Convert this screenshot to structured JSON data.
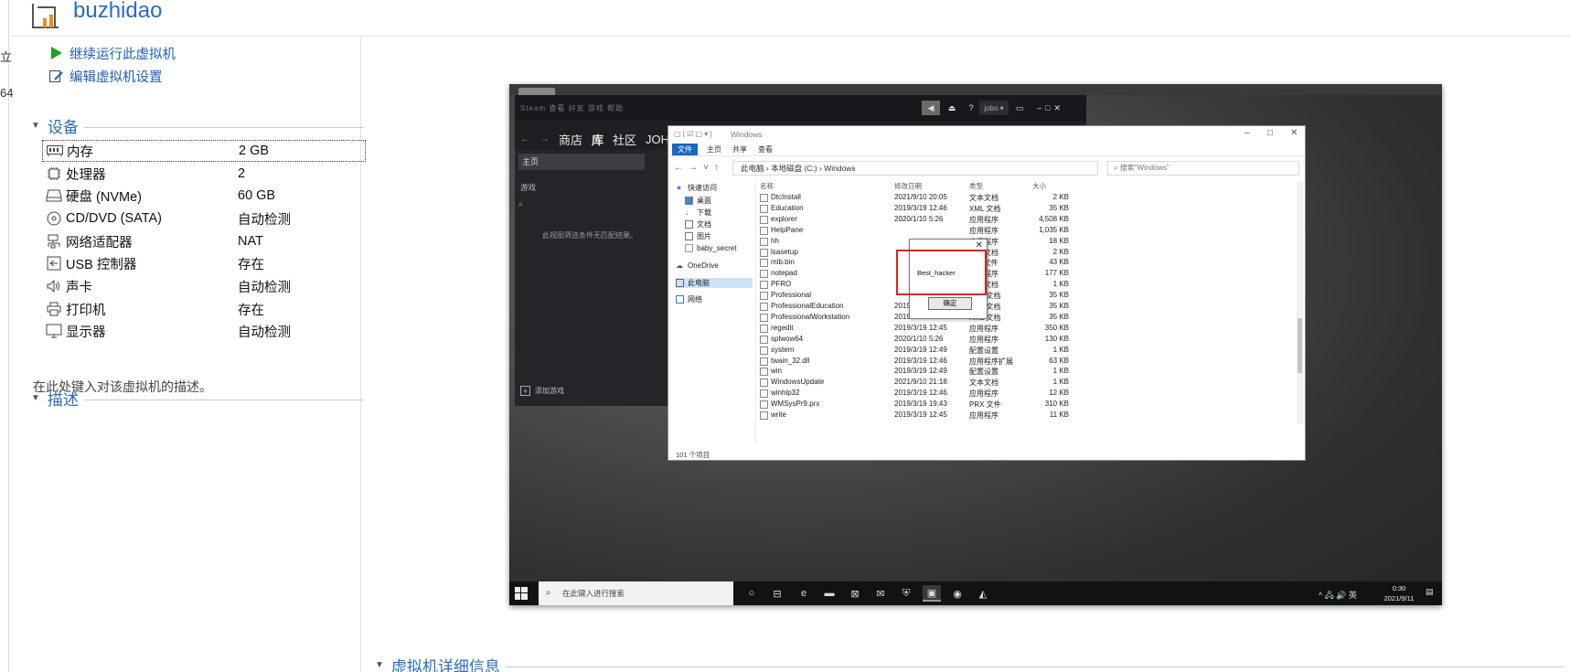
{
  "sliver": {
    "char1": "立",
    "char2": "64"
  },
  "vm": {
    "name": "buzhidao"
  },
  "actions": {
    "run": "继续运行此虚拟机",
    "edit": "编辑虚拟机设置"
  },
  "devices_section": {
    "title": "设备",
    "items": [
      {
        "icon": "memory-icon",
        "name": "内存",
        "value": "2 GB"
      },
      {
        "icon": "processor-icon",
        "name": "处理器",
        "value": "2"
      },
      {
        "icon": "harddisk-icon",
        "name": "硬盘 (NVMe)",
        "value": "60 GB"
      },
      {
        "icon": "cd-dvd-icon",
        "name": "CD/DVD (SATA)",
        "value": "自动检测"
      },
      {
        "icon": "network-adapter-icon",
        "name": "网络适配器",
        "value": "NAT"
      },
      {
        "icon": "usb-icon",
        "name": "USB 控制器",
        "value": "存在"
      },
      {
        "icon": "sound-card-icon",
        "name": "声卡",
        "value": "自动检测"
      },
      {
        "icon": "printer-icon",
        "name": "打印机",
        "value": "存在"
      },
      {
        "icon": "display-icon",
        "name": "显示器",
        "value": "自动检测"
      }
    ]
  },
  "description_section": {
    "title": "描述",
    "placeholder": "在此处键入对该虚拟机的描述。"
  },
  "details_section": {
    "title": "虚拟机详细信息"
  },
  "screen": {
    "steam": {
      "menu": "Steam  查看  好友  游戏  帮助",
      "user": "jobo ▾",
      "nav": [
        "商店",
        "库",
        "社区",
        "JOHN"
      ],
      "home": "主页",
      "games": "游戏",
      "empty": "此视图筛选条件无匹配结果。",
      "add": "添加游戏"
    },
    "explorer": {
      "title": "Windows",
      "ribbon_tabs": [
        "文件",
        "主页",
        "共享",
        "查看"
      ],
      "path": [
        "此电脑",
        "本地磁盘 (C:)",
        "Windows"
      ],
      "search": "搜索\"Windows\"",
      "nav": [
        "快速访问",
        "桌面",
        "下载",
        "文档",
        "图片",
        "baby_secret",
        "OneDrive",
        "此电脑",
        "网络"
      ],
      "columns": [
        "名称",
        "修改日期",
        "类型",
        "大小"
      ],
      "files": [
        {
          "name": "DtcInstall",
          "date": "2021/9/10 20:05",
          "type": "文本文档",
          "size": "2 KB"
        },
        {
          "name": "Education",
          "date": "2019/3/19 12:46",
          "type": "XML 文档",
          "size": "35 KB"
        },
        {
          "name": "explorer",
          "date": "2020/1/10 5:26",
          "type": "应用程序",
          "size": "4,508 KB"
        },
        {
          "name": "HelpPane",
          "date": "",
          "type": "应用程序",
          "size": "1,035 KB"
        },
        {
          "name": "hh",
          "date": "",
          "type": "应用程序",
          "size": "18 KB"
        },
        {
          "name": "lsasetup",
          "date": "",
          "type": "文本文档",
          "size": "2 KB"
        },
        {
          "name": "mib.bin",
          "date": "",
          "type": "BIN 文件",
          "size": "43 KB"
        },
        {
          "name": "notepad",
          "date": "",
          "type": "应用程序",
          "size": "177 KB"
        },
        {
          "name": "PFRO",
          "date": "",
          "type": "文本文档",
          "size": "1 KB"
        },
        {
          "name": "Professional",
          "date": "",
          "type": "XML 文档",
          "size": "35 KB"
        },
        {
          "name": "ProfessionalEducation",
          "date": "2019/3/19 12:46",
          "type": "XML 文档",
          "size": "35 KB"
        },
        {
          "name": "ProfessionalWorkstation",
          "date": "2019/3/19 12:46",
          "type": "XML 文档",
          "size": "35 KB"
        },
        {
          "name": "regedit",
          "date": "2019/3/19 12:45",
          "type": "应用程序",
          "size": "350 KB"
        },
        {
          "name": "splwow64",
          "date": "2020/1/10 5:26",
          "type": "应用程序",
          "size": "130 KB"
        },
        {
          "name": "system",
          "date": "2019/3/19 12:49",
          "type": "配置设置",
          "size": "1 KB"
        },
        {
          "name": "twain_32.dll",
          "date": "2019/3/19 12:46",
          "type": "应用程序扩展",
          "size": "63 KB"
        },
        {
          "name": "win",
          "date": "2019/3/19 12:49",
          "type": "配置设置",
          "size": "1 KB"
        },
        {
          "name": "WindowsUpdate",
          "date": "2021/9/10 21:18",
          "type": "文本文档",
          "size": "1 KB"
        },
        {
          "name": "winhlp32",
          "date": "2019/3/19 12:46",
          "type": "应用程序",
          "size": "12 KB"
        },
        {
          "name": "WMSysPr9.prx",
          "date": "2019/3/19 19:43",
          "type": "PRX 文件",
          "size": "310 KB"
        },
        {
          "name": "write",
          "date": "2019/3/19 12:45",
          "type": "应用程序",
          "size": "11 KB"
        }
      ],
      "status": "101 个项目"
    },
    "dialog": {
      "message": "Best_hacker",
      "ok": "确定"
    },
    "taskbar": {
      "search": "在此键入进行搜索",
      "tray": "^ 🖧 🔊 英",
      "time": "0:30",
      "date": "2021/9/11"
    }
  }
}
